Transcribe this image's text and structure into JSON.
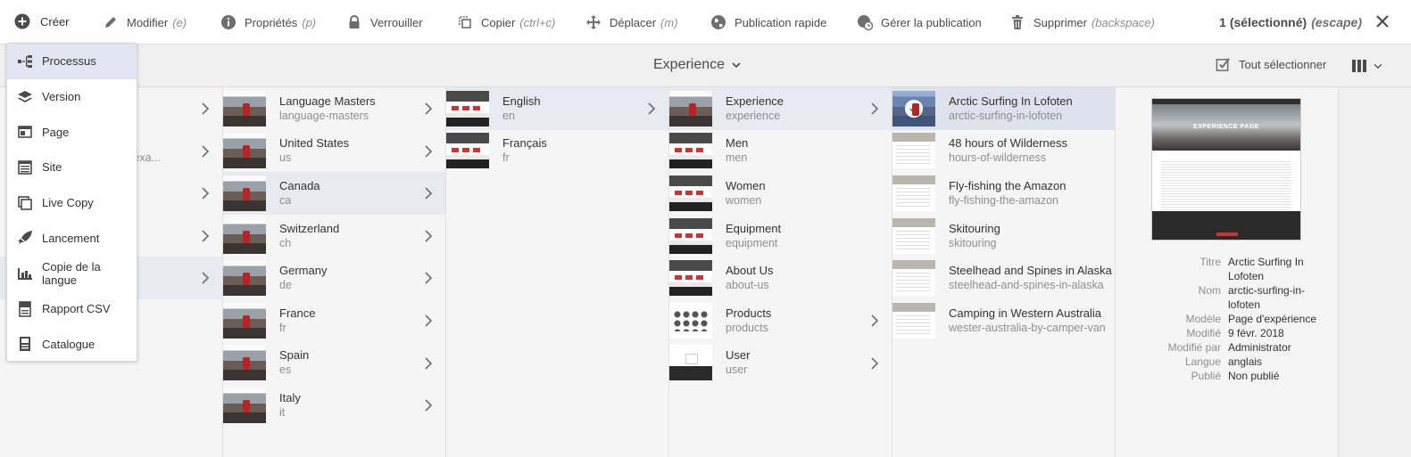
{
  "actionbar": {
    "create": "Créer",
    "edit": {
      "label": "Modifier",
      "shortcut": "(e)"
    },
    "properties": {
      "label": "Propriétés",
      "shortcut": "(p)"
    },
    "lock": {
      "label": "Verrouiller"
    },
    "copy": {
      "label": "Copier",
      "shortcut": "(ctrl+c)"
    },
    "move": {
      "label": "Déplacer",
      "shortcut": "(m)"
    },
    "quickpublish": {
      "label": "Publication rapide"
    },
    "managepublish": {
      "label": "Gérer la publication"
    },
    "delete": {
      "label": "Supprimer",
      "shortcut": "(backspace)"
    },
    "selection": {
      "label": "1 (sélectionné)",
      "shortcut": "(escape)"
    }
  },
  "titlebar": {
    "title": "Experience",
    "select_all": "Tout sélectionner"
  },
  "create_menu": {
    "items": [
      {
        "label": "Processus",
        "icon": "workflow-icon"
      },
      {
        "label": "Version",
        "icon": "layers-icon"
      },
      {
        "label": "Page",
        "icon": "page-icon"
      },
      {
        "label": "Site",
        "icon": "site-icon"
      },
      {
        "label": "Live Copy",
        "icon": "livecopy-icon"
      },
      {
        "label": "Lancement",
        "icon": "launch-icon"
      },
      {
        "label": "Copie de la langue",
        "icon": "language-copy-icon"
      },
      {
        "label": "Rapport CSV",
        "icon": "report-icon"
      },
      {
        "label": "Catalogue",
        "icon": "catalog-icon"
      }
    ]
  },
  "column0": {
    "partial_title": "s",
    "partial_sub": "s-exa..."
  },
  "column1": [
    {
      "title": "Language Masters",
      "name": "language-masters"
    },
    {
      "title": "United States",
      "name": "us"
    },
    {
      "title": "Canada",
      "name": "ca"
    },
    {
      "title": "Switzerland",
      "name": "ch"
    },
    {
      "title": "Germany",
      "name": "de"
    },
    {
      "title": "France",
      "name": "fr"
    },
    {
      "title": "Spain",
      "name": "es"
    },
    {
      "title": "Italy",
      "name": "it"
    }
  ],
  "column2": [
    {
      "title": "English",
      "name": "en"
    },
    {
      "title": "Français",
      "name": "fr"
    }
  ],
  "column3": [
    {
      "title": "Experience",
      "name": "experience"
    },
    {
      "title": "Men",
      "name": "men"
    },
    {
      "title": "Women",
      "name": "women"
    },
    {
      "title": "Equipment",
      "name": "equipment"
    },
    {
      "title": "About Us",
      "name": "about-us"
    },
    {
      "title": "Products",
      "name": "products"
    },
    {
      "title": "User",
      "name": "user"
    }
  ],
  "column4": [
    {
      "title": "Arctic Surfing In Lofoten",
      "name": "arctic-surfing-in-lofoten"
    },
    {
      "title": "48 hours of Wilderness",
      "name": "hours-of-wilderness"
    },
    {
      "title": "Fly-fishing the Amazon",
      "name": "fly-fishing-the-amazon"
    },
    {
      "title": "Skitouring",
      "name": "skitouring"
    },
    {
      "title": "Steelhead and Spines in Alaska",
      "name": "steelhead-and-spines-in-alaska"
    },
    {
      "title": "Camping in Western Australia",
      "name": "wester-australia-by-camper-van"
    }
  ],
  "preview": {
    "hero_text": "EXPERIENCE PAGE",
    "properties": [
      {
        "key": "Titre",
        "value": "Arctic Surfing In Lofoten"
      },
      {
        "key": "Nom",
        "value": "arctic-surfing-in-lofoten"
      },
      {
        "key": "Modèle",
        "value": "Page d'expérience"
      },
      {
        "key": "Modifié",
        "value": "9 févr. 2018"
      },
      {
        "key": "Modifié par",
        "value": "Administrator"
      },
      {
        "key": "Langue",
        "value": "anglais"
      },
      {
        "key": "Publié",
        "value": "Non publié"
      }
    ]
  }
}
